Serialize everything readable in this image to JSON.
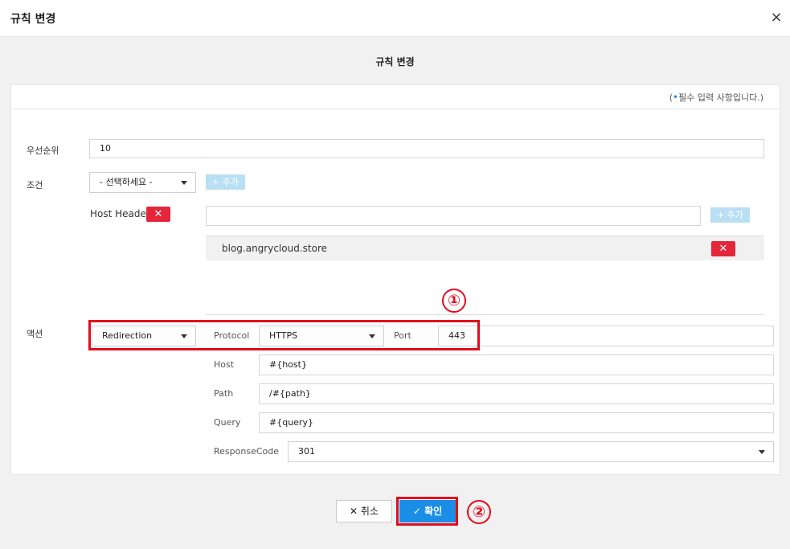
{
  "dialog": {
    "title": "규칙 변경",
    "close_icon": "×"
  },
  "section_title": "규칙 변경",
  "required_note": {
    "prefix": "(",
    "dot": "•",
    "text": "필수 입력 사항입니다.)"
  },
  "priority": {
    "label": "우선순위",
    "value": "10"
  },
  "condition": {
    "label": "조건",
    "select_value": "- 선택하세요 -",
    "add_label": "+ 추가",
    "host_header_label": "Host Header",
    "host_input_value": "",
    "host_add_label": "+ 추가",
    "hosts": [
      "blog.angrycloud.store"
    ]
  },
  "action": {
    "label": "액션",
    "type_value": "Redirection",
    "protocol_label": "Protocol",
    "protocol_value": "HTTPS",
    "port_label": "Port",
    "port_value": "443",
    "host_label": "Host",
    "host_value": "#{host}",
    "path_label": "Path",
    "path_value": "/#{path}",
    "query_label": "Query",
    "query_value": "#{query}",
    "response_code_label": "ResponseCode",
    "response_code_value": "301"
  },
  "markers": {
    "one": "①",
    "two": "②"
  },
  "footer": {
    "cancel_label": "취소",
    "ok_label": "확인"
  },
  "colors": {
    "primary": "#1a8ee6",
    "danger": "#e5263a",
    "highlight": "#e30b1c",
    "add_button": "#b9dff4"
  }
}
